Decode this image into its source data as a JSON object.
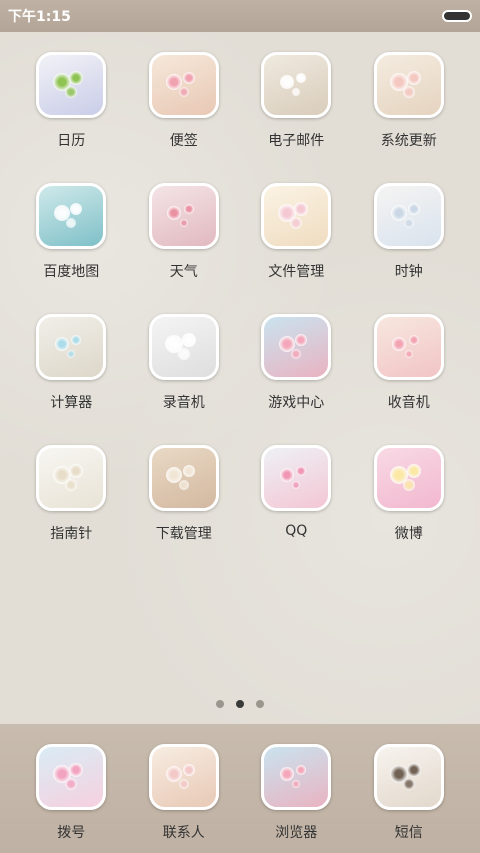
{
  "status": {
    "time": "下午1:15"
  },
  "apps": [
    {
      "label": "日历",
      "icon": "calendar-icon",
      "bg": [
        "#f2f2f7",
        "#c9cde8"
      ],
      "accent": "#8bc34a"
    },
    {
      "label": "便签",
      "icon": "notes-icon",
      "bg": [
        "#f6e8da",
        "#e8c8b4"
      ],
      "accent": "#f19fb0"
    },
    {
      "label": "电子邮件",
      "icon": "email-icon",
      "bg": [
        "#efe9df",
        "#d9cdbb"
      ],
      "accent": "#ffffff"
    },
    {
      "label": "系统更新",
      "icon": "system-update-icon",
      "bg": [
        "#f4ece0",
        "#e5d3bf"
      ],
      "accent": "#f5c6c0"
    },
    {
      "label": "百度地图",
      "icon": "baidu-map-icon",
      "bg": [
        "#cfe9ea",
        "#7fc0c8"
      ],
      "accent": "#ffffff"
    },
    {
      "label": "天气",
      "icon": "weather-icon",
      "bg": [
        "#f4e4e6",
        "#e1b9bf"
      ],
      "accent": "#ea8fa0"
    },
    {
      "label": "文件管理",
      "icon": "file-manager-icon",
      "bg": [
        "#fbf3e4",
        "#efdcc0"
      ],
      "accent": "#f4c7d4"
    },
    {
      "label": "时钟",
      "icon": "clock-icon",
      "bg": [
        "#f5f4f2",
        "#d9e3ee"
      ],
      "accent": "#c9d6e4"
    },
    {
      "label": "计算器",
      "icon": "calculator-icon",
      "bg": [
        "#f1efe9",
        "#ddd7c9"
      ],
      "accent": "#a9dcea"
    },
    {
      "label": "录音机",
      "icon": "recorder-icon",
      "bg": [
        "#f4f4f4",
        "#dedede"
      ],
      "accent": "#ffffff"
    },
    {
      "label": "游戏中心",
      "icon": "game-center-icon",
      "bg": [
        "#c9e3ef",
        "#e9b3c1"
      ],
      "accent": "#f6a5b8"
    },
    {
      "label": "收音机",
      "icon": "radio-icon",
      "bg": [
        "#f7e7df",
        "#f1c4c6"
      ],
      "accent": "#f3a1b0"
    },
    {
      "label": "指南针",
      "icon": "compass-icon",
      "bg": [
        "#f7f6f2",
        "#e9e3d6"
      ],
      "accent": "#e7dcc6"
    },
    {
      "label": "下载管理",
      "icon": "download-manager-icon",
      "bg": [
        "#e9d9c5",
        "#d3b8a0"
      ],
      "accent": "#f2e8d8"
    },
    {
      "label": "QQ",
      "icon": "qq-icon",
      "bg": [
        "#eef1f5",
        "#f3c6d4"
      ],
      "accent": "#f093b2"
    },
    {
      "label": "微博",
      "icon": "weibo-icon",
      "bg": [
        "#f8d9e4",
        "#f2b8cf"
      ],
      "accent": "#fbeaa2"
    }
  ],
  "dock": [
    {
      "label": "拨号",
      "icon": "phone-icon",
      "bg": [
        "#d9ecf5",
        "#f6d0df"
      ],
      "accent": "#f3a0bd"
    },
    {
      "label": "联系人",
      "icon": "contacts-icon",
      "bg": [
        "#f7ece1",
        "#e8c9b6"
      ],
      "accent": "#f3c8c8"
    },
    {
      "label": "浏览器",
      "icon": "browser-icon",
      "bg": [
        "#c9e3ef",
        "#e9b3c1"
      ],
      "accent": "#f6a5b8"
    },
    {
      "label": "短信",
      "icon": "messages-icon",
      "bg": [
        "#f7f3ee",
        "#e2d8cc"
      ],
      "accent": "#6b5b4e"
    }
  ],
  "pages": {
    "count": 3,
    "active": 1
  }
}
